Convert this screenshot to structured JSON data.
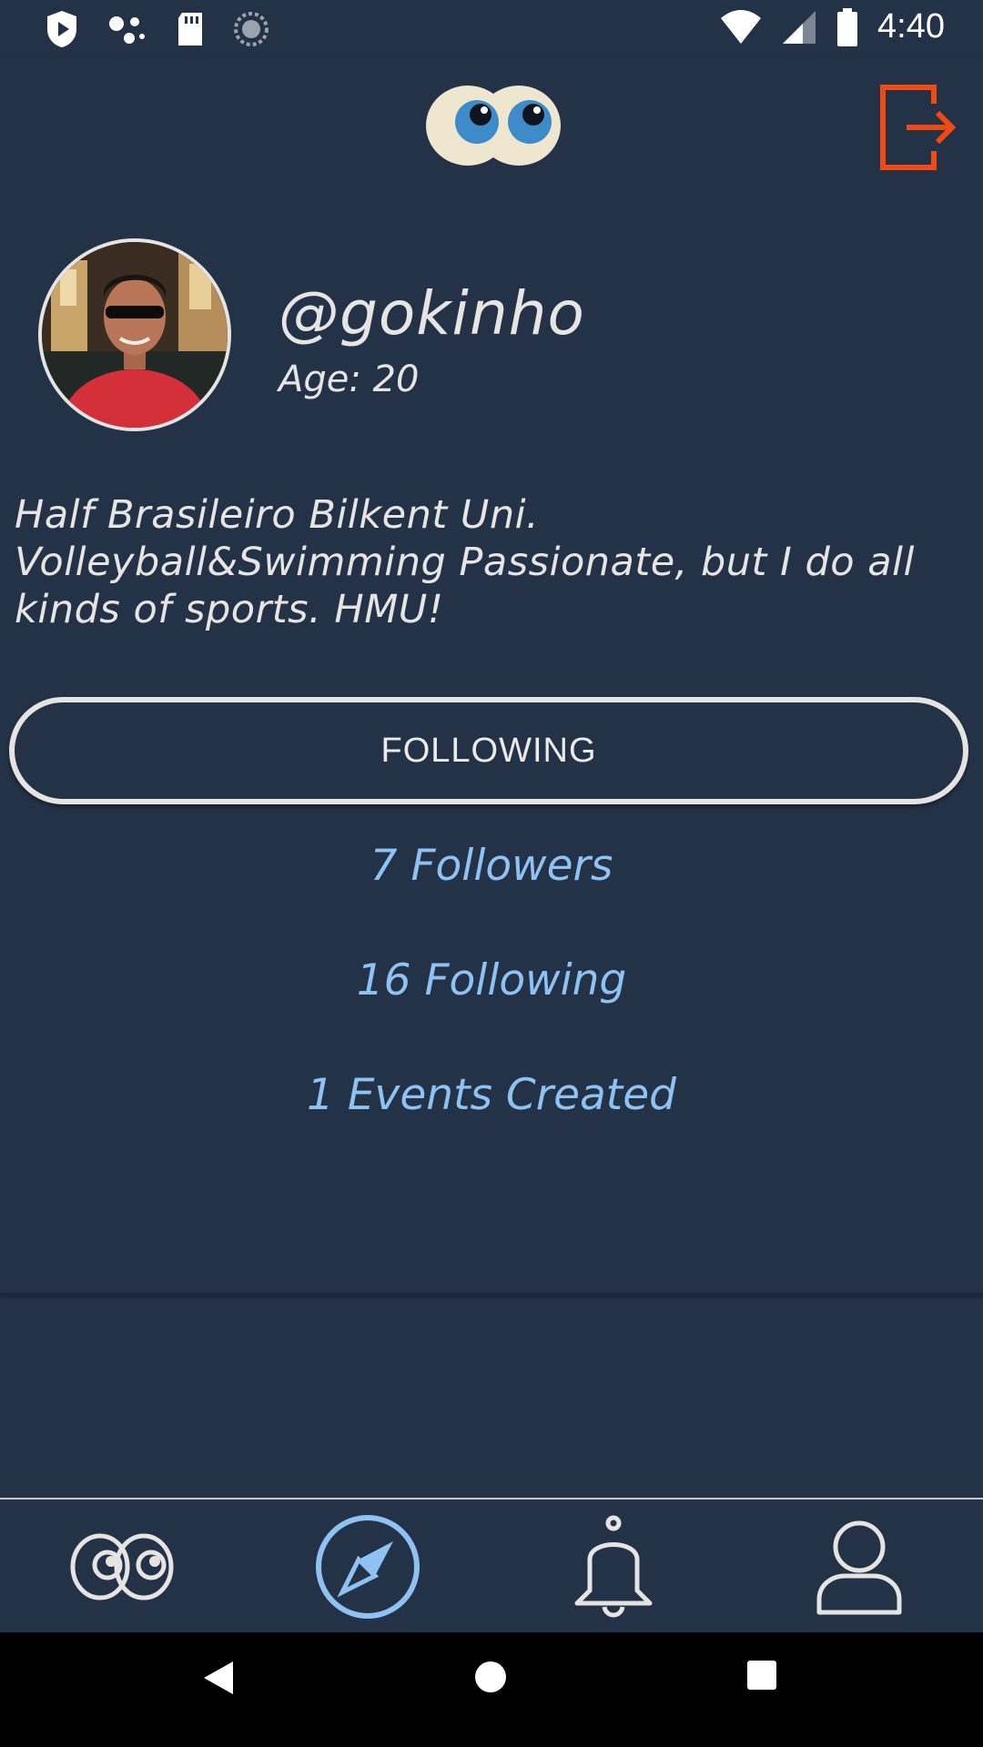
{
  "status_bar": {
    "time": "4:40",
    "left_icons": [
      "play-protect-icon",
      "assistant-dots-icon",
      "sd-card-icon",
      "sync-icon"
    ],
    "right_icons": [
      "wifi-icon",
      "signal-icon",
      "battery-icon"
    ]
  },
  "header": {
    "logo": "googly-eyes-logo",
    "logout_icon": "logout-icon",
    "accent_color": "#f04a12"
  },
  "profile": {
    "username": "@gokinho",
    "age": "Age: 20",
    "bio": "Half Brasileiro Bilkent Uni. Volleyball&Swimming Passionate, but I do all kinds of sports. HMU!",
    "follow_button_label": "FOLLOWING",
    "followers": "7 Followers",
    "following": "16 Following",
    "events_created": "1 Events Created",
    "link_color": "#8ec2f3"
  },
  "bottom_nav": {
    "items": [
      {
        "icon": "eyes-icon",
        "active": false
      },
      {
        "icon": "compass-icon",
        "active": true
      },
      {
        "icon": "bell-icon",
        "active": false
      },
      {
        "icon": "profile-icon",
        "active": false
      }
    ],
    "active_color": "#8ec2f3",
    "inactive_color": "#e6e3e3"
  },
  "system_nav": {
    "buttons": [
      "back-icon",
      "home-icon",
      "recents-icon"
    ]
  }
}
